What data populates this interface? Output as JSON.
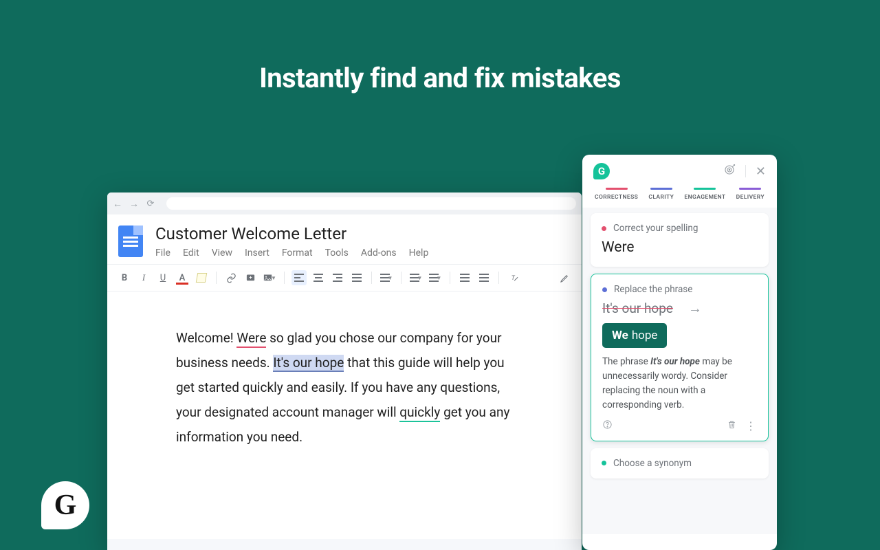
{
  "hero": {
    "title": "Instantly find and fix mistakes"
  },
  "docs": {
    "title": "Customer Welcome Letter",
    "menu": [
      "File",
      "Edit",
      "View",
      "Insert",
      "Format",
      "Tools",
      "Add-ons",
      "Help"
    ],
    "body": {
      "pre": "Welcome! ",
      "err_red": "Were",
      "mid1": " so glad you chose our company for your business needs. ",
      "hl_blue": "It's our hope",
      "mid2": " that this guide will help you get started quickly and easily. If you have any questions, your designated account manager will ",
      "err_grn": "quickly",
      "post": " get you any information you need."
    }
  },
  "grammarly": {
    "categories": [
      {
        "label": "CORRECTNESS",
        "color": "red"
      },
      {
        "label": "CLARITY",
        "color": "blue"
      },
      {
        "label": "ENGAGEMENT",
        "color": "grn"
      },
      {
        "label": "DELIVERY",
        "color": "pur"
      }
    ],
    "cards": {
      "spelling": {
        "label": "Correct your spelling",
        "word": "Were"
      },
      "phrase": {
        "label": "Replace the phrase",
        "strike": "It's our hope",
        "suggest_bold": "We",
        "suggest_rest": "hope",
        "explain_pre": "The phrase ",
        "explain_em": "It's our hope",
        "explain_post": " may be unnecessarily wordy. Consider replacing the noun with a corresponding verb."
      },
      "synonym": {
        "label": "Choose a synonym"
      }
    }
  }
}
